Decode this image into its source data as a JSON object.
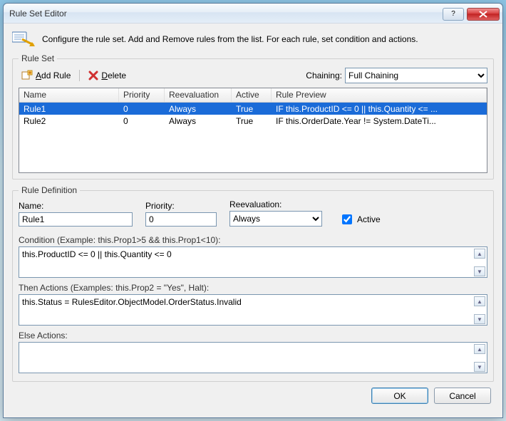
{
  "window": {
    "title": "Rule Set Editor"
  },
  "header": {
    "text": "Configure the rule set. Add and Remove rules from the list. For each rule, set condition and actions."
  },
  "toolbar": {
    "add_label": "Add Rule",
    "delete_label": "Delete",
    "chaining_label": "Chaining:",
    "chaining_value": "Full Chaining"
  },
  "grid": {
    "columns": {
      "name": "Name",
      "priority": "Priority",
      "reeval": "Reevaluation",
      "active": "Active",
      "preview": "Rule Preview"
    },
    "rows": [
      {
        "name": "Rule1",
        "priority": "0",
        "reeval": "Always",
        "active": "True",
        "preview": "IF this.ProductID <= 0 || this.Quantity <= ...",
        "selected": true
      },
      {
        "name": "Rule2",
        "priority": "0",
        "reeval": "Always",
        "active": "True",
        "preview": "IF this.OrderDate.Year != System.DateTi...",
        "selected": false
      }
    ]
  },
  "definition": {
    "legend": "Rule Definition",
    "name_label": "Name:",
    "name_value": "Rule1",
    "priority_label": "Priority:",
    "priority_value": "0",
    "reeval_label": "Reevaluation:",
    "reeval_value": "Always",
    "active_label": "Active",
    "active_checked": true,
    "condition_label": "Condition (Example: this.Prop1>5 && this.Prop1<10):",
    "condition_value": "this.ProductID <= 0 || this.Quantity <= 0",
    "then_label": "Then Actions (Examples: this.Prop2 = \"Yes\", Halt):",
    "then_value": "this.Status = RulesEditor.ObjectModel.OrderStatus.Invalid",
    "else_label": "Else Actions:",
    "else_value": ""
  },
  "ruleset_legend": "Rule Set",
  "footer": {
    "ok": "OK",
    "cancel": "Cancel"
  }
}
